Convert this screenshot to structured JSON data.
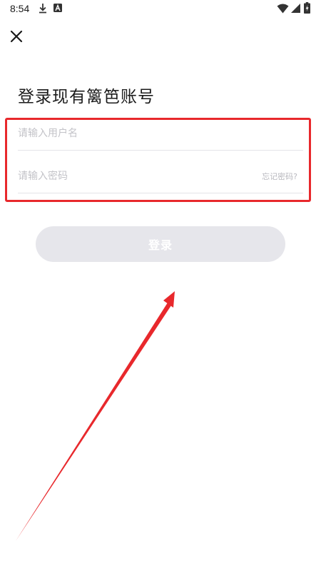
{
  "status_bar": {
    "time": "8:54",
    "icons": [
      "download-icon",
      "a-notification-icon",
      "wifi-icon",
      "signal-icon",
      "battery-icon"
    ]
  },
  "header": {
    "close_icon": "close-icon"
  },
  "login": {
    "title": "登录现有篱笆账号",
    "username_placeholder": "请输入用户名",
    "password_placeholder": "请输入密码",
    "forgot_password": "忘记密码?",
    "submit_label": "登录"
  },
  "colors": {
    "highlight_border": "#e8282c",
    "annotation_arrow": "#e8282c",
    "button_disabled_bg": "#e6e6eb",
    "placeholder_text": "#c3c3c8"
  }
}
